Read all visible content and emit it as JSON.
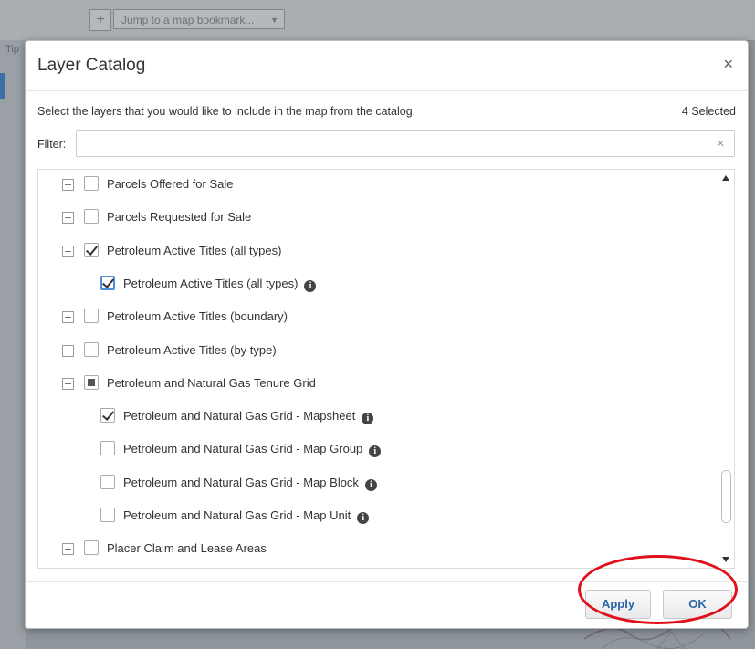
{
  "background": {
    "add_button": "+",
    "bookmark_placeholder": "Jump to a map bookmark...",
    "side_label": "Tip"
  },
  "dialog": {
    "title": "Layer Catalog",
    "close": "×",
    "instructions": "Select the layers that you would like to include in the map from the catalog.",
    "selected_count": "4 Selected",
    "filter_label": "Filter:",
    "filter_value": "",
    "filter_clear": "×",
    "layers": [
      {
        "expander": "+",
        "label": "Parcels Offered for Sale",
        "state": "unchecked"
      },
      {
        "expander": "+",
        "label": "Parcels Requested for Sale",
        "state": "unchecked"
      },
      {
        "expander": "−",
        "label": "Petroleum Active Titles (all types)",
        "state": "checked"
      },
      {
        "label": "Petroleum Active Titles (all types)",
        "state": "checked",
        "child": true,
        "info": true
      },
      {
        "expander": "+",
        "label": "Petroleum Active Titles (boundary)",
        "state": "unchecked"
      },
      {
        "expander": "+",
        "label": "Petroleum Active Titles (by type)",
        "state": "unchecked"
      },
      {
        "expander": "−",
        "label": "Petroleum and Natural Gas Tenure Grid",
        "state": "partial"
      },
      {
        "label": "Petroleum and Natural Gas Grid - Mapsheet",
        "state": "checked",
        "child": true,
        "info": true
      },
      {
        "label": "Petroleum and Natural Gas Grid - Map Group",
        "state": "unchecked",
        "child": true,
        "info": true
      },
      {
        "label": "Petroleum and Natural Gas Grid - Map Block",
        "state": "unchecked",
        "child": true,
        "info": true
      },
      {
        "label": "Petroleum and Natural Gas Grid - Map Unit",
        "state": "unchecked",
        "child": true,
        "info": true
      },
      {
        "expander": "+",
        "label": "Placer Claim and Lease Areas",
        "state": "unchecked"
      }
    ],
    "info_glyph": "i",
    "apply_label": "Apply",
    "ok_label": "OK"
  },
  "colors": {
    "accent": "#2a64a8",
    "annotation": "#e0101b",
    "focus": "#4d90d6"
  }
}
